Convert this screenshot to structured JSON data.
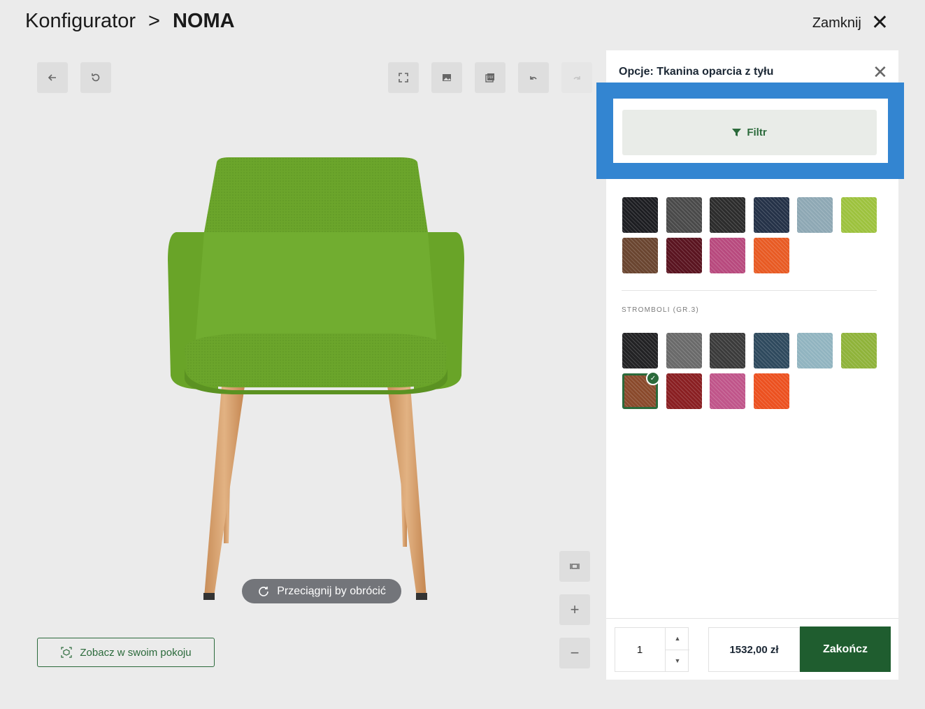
{
  "header": {
    "breadcrumb_root": "Konfigurator",
    "breadcrumb_sep": ">",
    "breadcrumb_current": "NOMA",
    "close_label": "Zamknij"
  },
  "viewer": {
    "drag_hint": "Przeciągnij by obrócić",
    "ar_button_label": "Zobacz w swoim pokoju",
    "zoom_in": "+",
    "zoom_out": "−"
  },
  "panel": {
    "title": "Opcje: Tkanina oparcia z tyłu",
    "filter_label": "Filtr",
    "group1_swatches": [
      "#1d1e22",
      "#4a4a4a",
      "#2c2c2c",
      "#253248",
      "#8ea8b4",
      "#9dc23e",
      "#6a4530",
      "#5a1420",
      "#b84a7e",
      "#e85b24"
    ],
    "group2_label": "STROMBOLI (GR.3)",
    "group2_swatches": [
      "#222224",
      "#6a6a6a",
      "#3b3b3b",
      "#2f4a5e",
      "#91b4c0",
      "#8fb33a",
      "#8a4a2c",
      "#8a1f22",
      "#c0558a",
      "#ec5120"
    ],
    "selected_swatch": "group2-6"
  },
  "bottom": {
    "quantity": "1",
    "price": "1532,00 zł",
    "finish_label": "Zakończ"
  },
  "colors": {
    "brand_green": "#1f5d2f",
    "highlight_blue": "#3385d1",
    "chair_green": "#6aa529",
    "leg_wood": "#d9a574"
  }
}
